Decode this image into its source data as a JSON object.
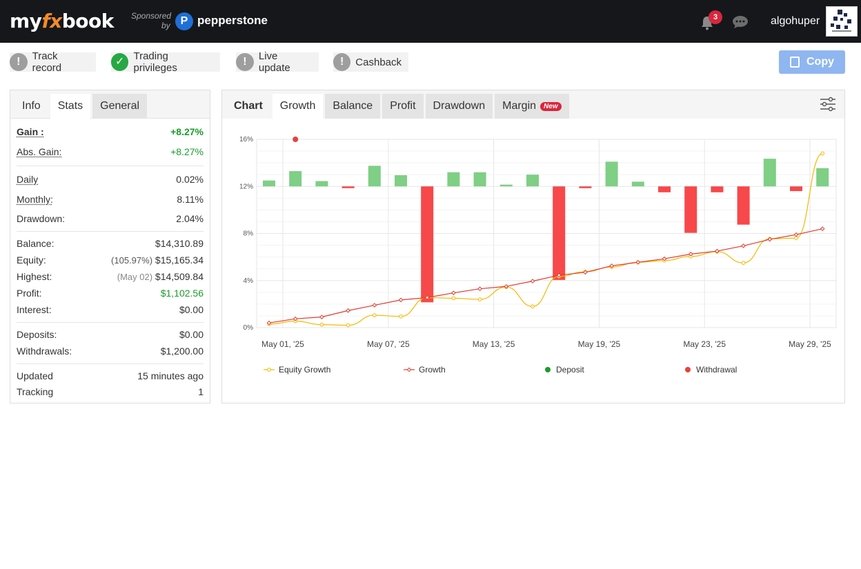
{
  "header": {
    "logo_my": "my",
    "logo_fx": "fx",
    "logo_book": "book",
    "sponsored": "Sponsored",
    "by": "by",
    "sponsor_icon": "P",
    "sponsor_name": "pepperstone",
    "notification_count": "3",
    "username": "algohuper"
  },
  "status": {
    "items": [
      {
        "label": "Track record",
        "state": "warning"
      },
      {
        "label": "Trading privileges",
        "state": "ok"
      },
      {
        "label": "Live update",
        "state": "warning"
      },
      {
        "label": "Cashback",
        "state": "warning"
      }
    ],
    "copy_label": "Copy"
  },
  "left_panel": {
    "tabs": [
      "Info",
      "Stats",
      "General"
    ],
    "active_tab": "Stats",
    "gain_label": "Gain :",
    "gain_value": "+8.27%",
    "abs_gain_label": "Abs. Gain:",
    "abs_gain_value": "+8.27%",
    "daily_label": "Daily",
    "daily_value": "0.02%",
    "monthly_label": "Monthly:",
    "monthly_value": "8.11%",
    "drawdown_label": "Drawdown:",
    "drawdown_value": "2.04%",
    "balance_label": "Balance:",
    "balance_value": "$14,310.89",
    "equity_label": "Equity:",
    "equity_pct": "(105.97%)",
    "equity_value": "$15,165.34",
    "highest_label": "Highest:",
    "highest_date": "(May 02)",
    "highest_value": "$14,509.84",
    "profit_label": "Profit:",
    "profit_value": "$1,102.56",
    "interest_label": "Interest:",
    "interest_value": "$0.00",
    "deposits_label": "Deposits:",
    "deposits_value": "$0.00",
    "withdrawals_label": "Withdrawals:",
    "withdrawals_value": "$1,200.00",
    "updated_label": "Updated",
    "updated_value": "15 minutes ago",
    "tracking_label": "Tracking",
    "tracking_value": "1"
  },
  "chart_panel": {
    "tabs": [
      "Chart",
      "Growth",
      "Balance",
      "Profit",
      "Drawdown",
      "Margin"
    ],
    "active_tab": "Growth",
    "margin_badge": "New"
  },
  "chart_data": {
    "type": "line",
    "y_ticks": [
      "0%",
      "4%",
      "8%",
      "12%",
      "16%"
    ],
    "ylim": [
      0,
      16
    ],
    "x_ticks": [
      "May 01, '25",
      "May 07, '25",
      "May 13, '25",
      "May 19, '25",
      "May 23, '25",
      "May 29, '25"
    ],
    "grid": true,
    "legend_position": "bottom",
    "legend": [
      "Equity Growth",
      "Growth",
      "Deposit",
      "Withdrawal"
    ],
    "colors": {
      "equity": "#f5b800",
      "growth": "#e03a2e",
      "deposit": "#1a9c2c",
      "withdrawal": "#e8413a",
      "bar_pos": "#7fcf85",
      "bar_neg": "#f7484a"
    },
    "points_count": 22,
    "series": [
      {
        "name": "Equity Growth",
        "values": [
          0.3,
          0.55,
          0.25,
          0.2,
          1.05,
          0.95,
          2.55,
          2.5,
          2.4,
          3.45,
          1.8,
          4.35,
          4.75,
          5.15,
          5.55,
          5.7,
          6.05,
          6.45,
          5.5,
          7.55,
          7.6,
          14.8
        ]
      },
      {
        "name": "Growth",
        "values": [
          0.4,
          0.75,
          0.9,
          1.45,
          1.9,
          2.35,
          2.55,
          2.95,
          3.3,
          3.5,
          3.95,
          4.45,
          4.7,
          5.25,
          5.55,
          5.85,
          6.25,
          6.5,
          6.95,
          7.5,
          7.9,
          8.4
        ]
      }
    ],
    "bars_baseline": 12,
    "bars": [
      0.5,
      1.3,
      0.45,
      -0.15,
      1.75,
      0.95,
      -9.85,
      1.2,
      1.2,
      0.15,
      1.0,
      -7.95,
      -0.15,
      2.1,
      0.4,
      -0.5,
      -3.95,
      -0.5,
      -3.25,
      2.35,
      -0.4,
      1.55
    ],
    "withdrawal_points": [
      {
        "index": 1,
        "value": 16
      }
    ]
  }
}
